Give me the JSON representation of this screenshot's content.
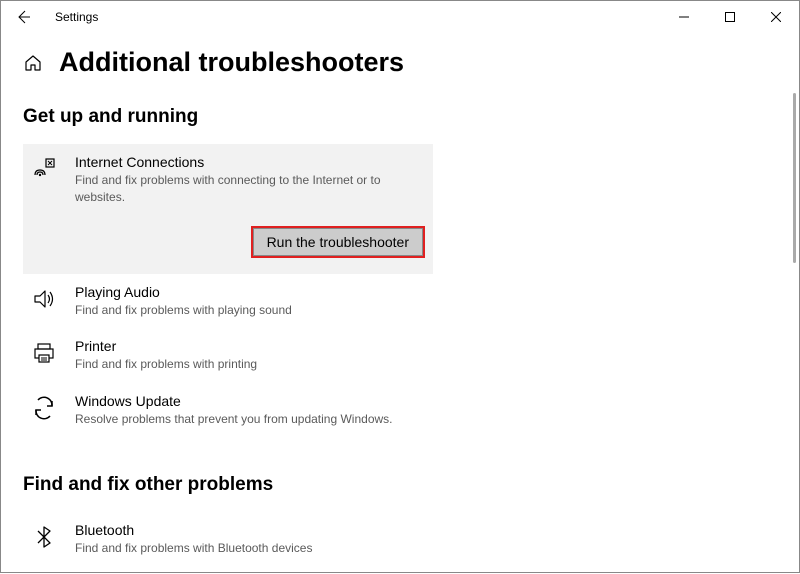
{
  "window": {
    "title": "Settings"
  },
  "page": {
    "title": "Additional troubleshooters"
  },
  "sections": {
    "get_up": {
      "heading": "Get up and running",
      "items": {
        "internet": {
          "title": "Internet Connections",
          "desc": "Find and fix problems with connecting to the Internet or to websites.",
          "run_label": "Run the troubleshooter"
        },
        "audio": {
          "title": "Playing Audio",
          "desc": "Find and fix problems with playing sound"
        },
        "printer": {
          "title": "Printer",
          "desc": "Find and fix problems with printing"
        },
        "update": {
          "title": "Windows Update",
          "desc": "Resolve problems that prevent you from updating Windows."
        }
      }
    },
    "find_fix": {
      "heading": "Find and fix other problems",
      "items": {
        "bluetooth": {
          "title": "Bluetooth",
          "desc": "Find and fix problems with Bluetooth devices"
        }
      }
    }
  }
}
